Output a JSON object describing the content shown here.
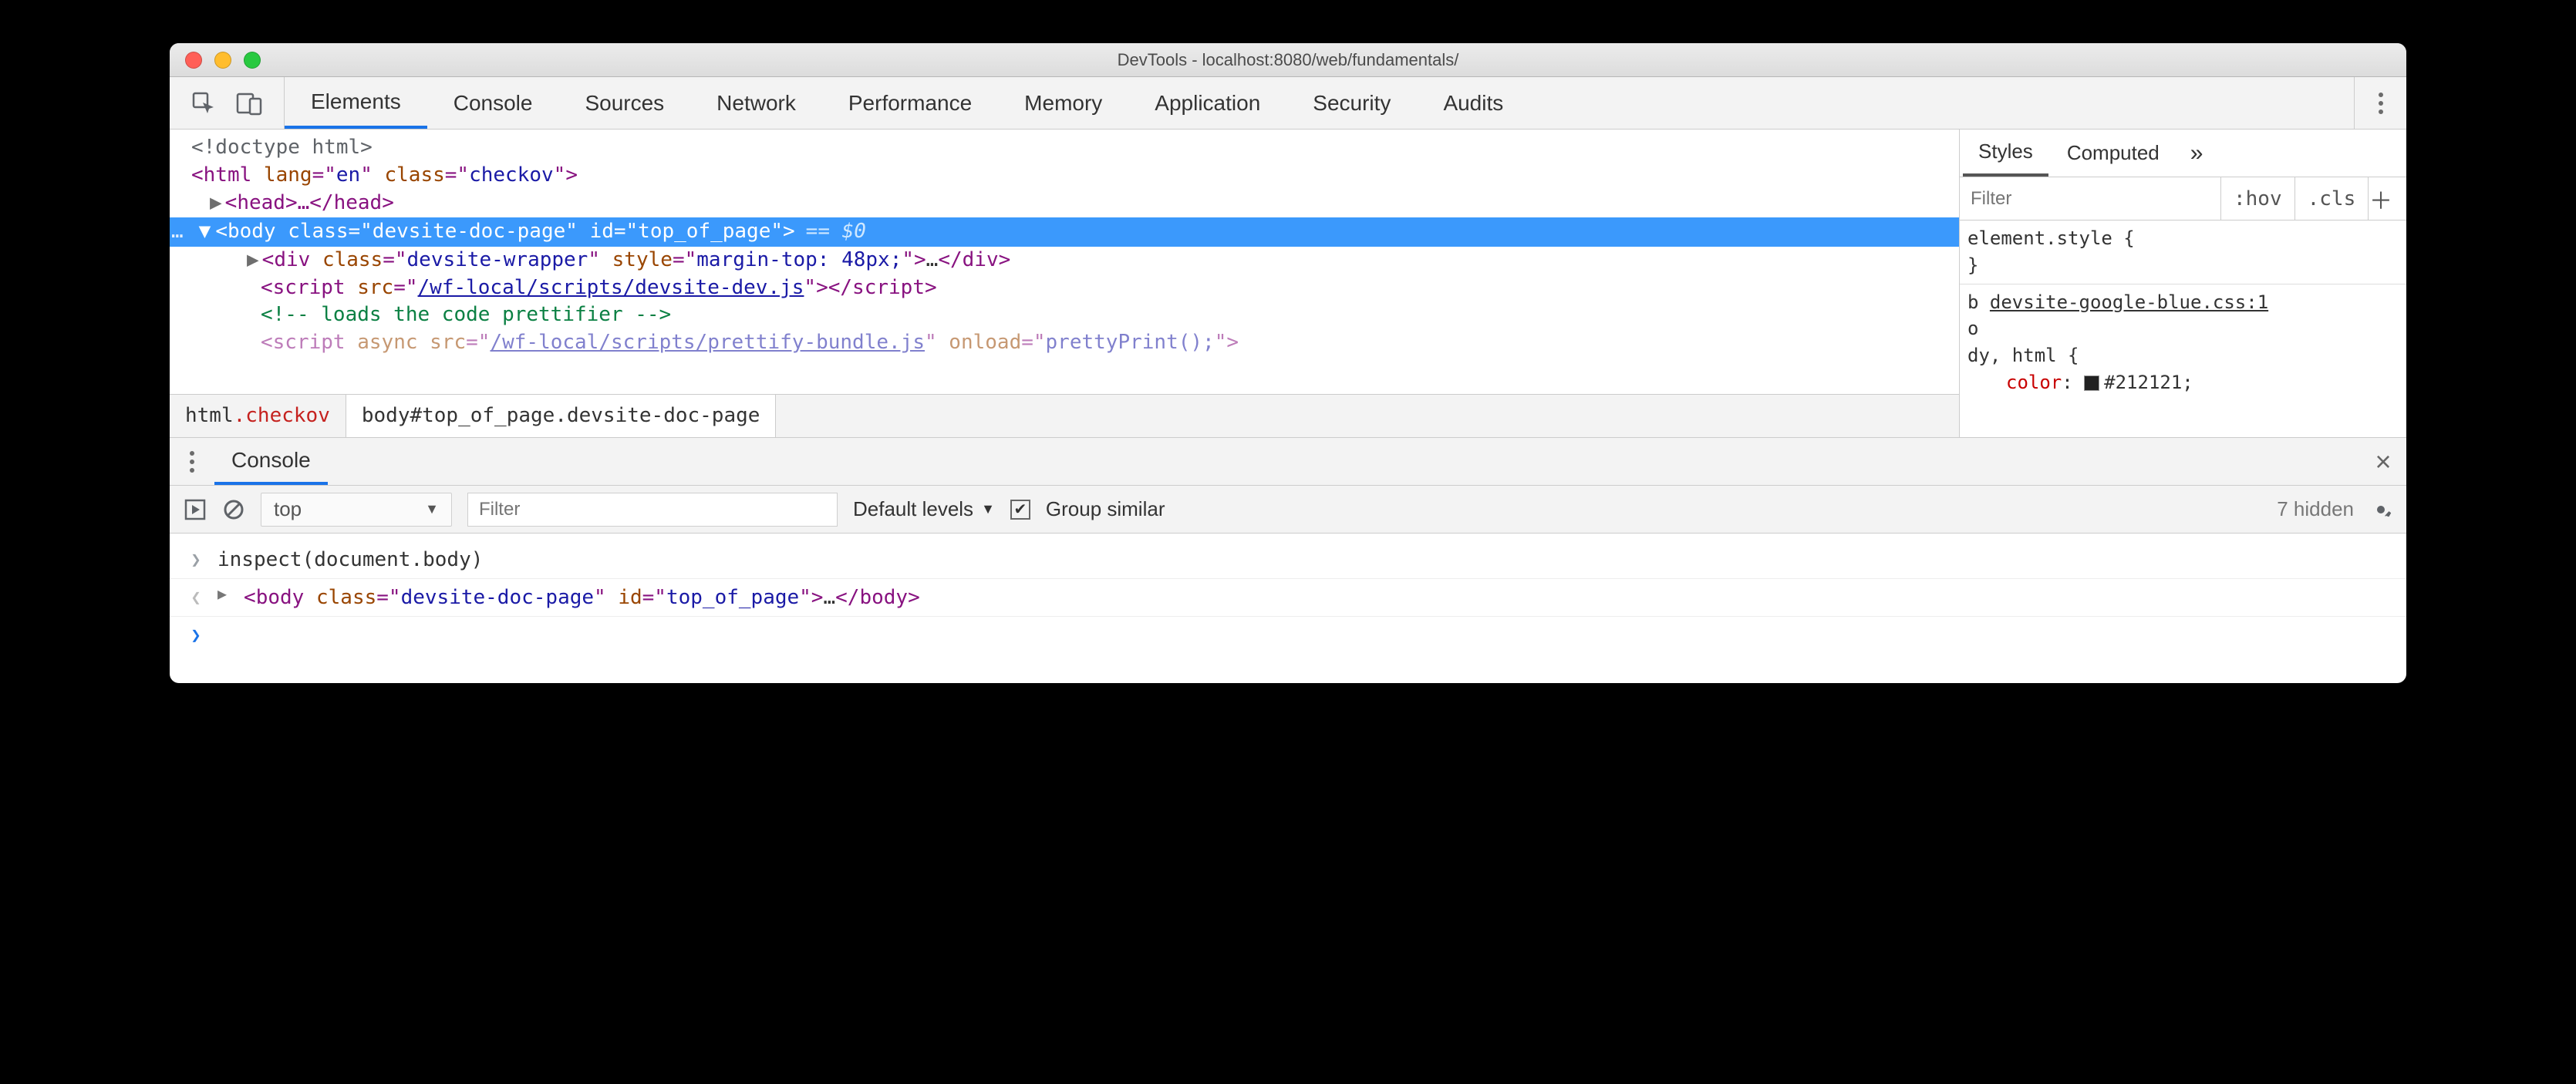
{
  "window_title": "DevTools - localhost:8080/web/fundamentals/",
  "tabs": [
    "Elements",
    "Console",
    "Sources",
    "Network",
    "Performance",
    "Memory",
    "Application",
    "Security",
    "Audits"
  ],
  "active_tab": "Elements",
  "dom": {
    "line1": "<!doctype html>",
    "line2_open": "<",
    "line2_tag": "html",
    "line2_attr1": " lang",
    "line2_eq": "=",
    "line2_q": "\"",
    "line2_val1": "en",
    "line2_attr2": " class",
    "line2_val2": "checkov",
    "line2_close": ">",
    "line3_tri": "▶",
    "line3_open": "<",
    "line3_tag": "head",
    "line3_mid": ">…</",
    "line3_close": ">",
    "sel_dots": "…",
    "sel_tri": "▼",
    "sel_text": "<body class=\"devsite-doc-page\" id=\"top_of_page\">",
    "sel_eq": " == ",
    "sel_dollar": "$0",
    "line5_tri": "▶",
    "line5": "<div class=\"devsite-wrapper\" style=\"margin-top: 48px;\">…</div>",
    "line5_tag": "div",
    "line5_attr_class": "class",
    "line5_val_class": "devsite-wrapper",
    "line5_attr_style": "style",
    "line5_val_style": "margin-top: 48px;",
    "line6_tag": "script",
    "line6_attr": "src",
    "line6_val": "/wf-local/scripts/devsite-dev.js",
    "line7": "<!-- loads the code prettifier -->",
    "line8_tag": "script",
    "line8_attr1": "async",
    "line8_attr2": "src",
    "line8_val2": "/wf-local/scripts/prettify-bundle.js",
    "line8_attr3": "onload",
    "line8_val3": "prettyPrint();"
  },
  "crumbs": {
    "c1_tag": "html",
    "c1_cls": ".checkov",
    "c2": "body#top_of_page.devsite-doc-page"
  },
  "styles": {
    "tabs": [
      "Styles",
      "Computed"
    ],
    "filter_placeholder": "Filter",
    "hov": ":hov",
    "cls": ".cls",
    "element_style_open": "element.style {",
    "element_style_close": "}",
    "src_prefix": "b ",
    "src_link": "devsite-google-blue.css:1",
    "src_o": "o",
    "rule_sel": "dy, html {",
    "rule_prop": "color",
    "rule_val": "#212121;"
  },
  "console_header": {
    "tab": "Console"
  },
  "console_toolbar": {
    "context": "top",
    "filter_placeholder": "Filter",
    "levels": "Default levels",
    "group": "Group similar",
    "hidden": "7 hidden"
  },
  "console_body": {
    "line1": "inspect(document.body)",
    "line2_tag": "body",
    "line2_attr_class": "class",
    "line2_val_class": "devsite-doc-page",
    "line2_attr_id": "id",
    "line2_val_id": "top_of_page"
  }
}
